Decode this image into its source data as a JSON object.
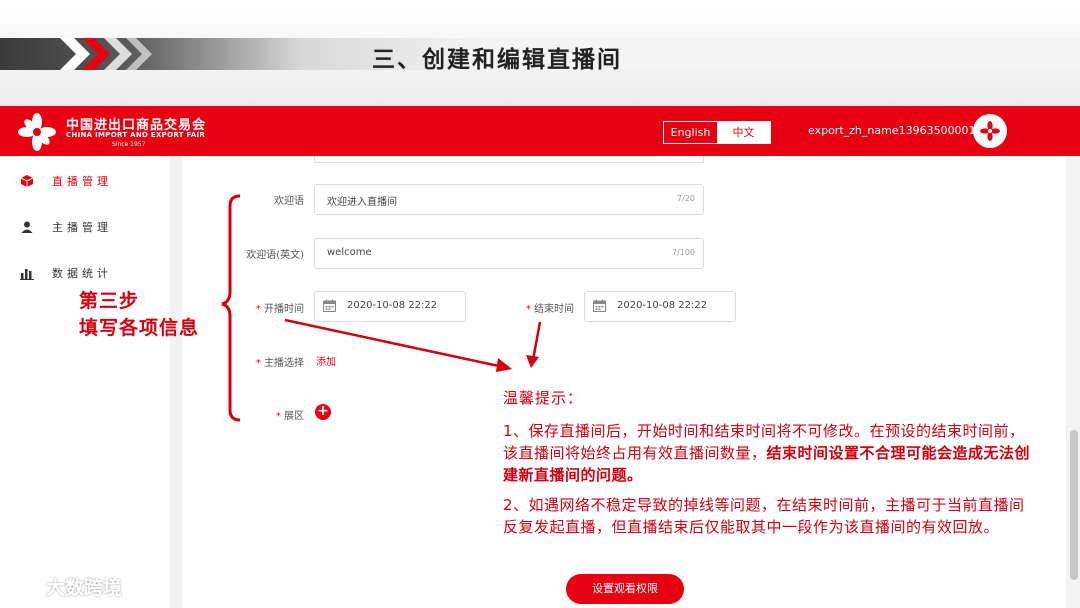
{
  "slide": {
    "title": "三、创建和编辑直播间"
  },
  "header": {
    "logo_cn": "中国进出口商品交易会",
    "logo_en": "CHINA IMPORT AND EXPORT FAIR",
    "logo_since": "Since 1957",
    "lang_en": "English",
    "lang_zh": "中文",
    "username": "export_zh_name13963500001"
  },
  "sidebar": {
    "items": [
      {
        "label": "直播管理",
        "icon": "cube-icon",
        "active": true
      },
      {
        "label": "主播管理",
        "icon": "user-icon",
        "active": false
      },
      {
        "label": "数据统计",
        "icon": "bar-chart-icon",
        "active": false
      }
    ]
  },
  "form": {
    "welcome": {
      "label": "欢迎语",
      "value": "欢迎进入直播间",
      "count": "7/20"
    },
    "welcome_en": {
      "label": "欢迎语(英文)",
      "value": "welcome",
      "count": "7/100"
    },
    "start_time": {
      "label": "开播时间",
      "value": "2020-10-08 22:22"
    },
    "end_time": {
      "label": "结束时间",
      "value": "2020-10-08 22:22"
    },
    "anchor": {
      "label": "主播选择",
      "link": "添加"
    },
    "booth": {
      "label": "展区",
      "button": "+"
    }
  },
  "annotation": {
    "step_line1": "第三步",
    "step_line2": "填写各项信息"
  },
  "tips": {
    "title": "温馨提示：",
    "p1_normal": "1、保存直播间后，开始时间和结束时间将不可修改。在预设的结束时间前，该直播间将始终占用有效直播间数量，",
    "p1_bold": "结束时间设置不合理可能会造成无法创建新直播间的问题。",
    "p2": "2、如遇网络不稳定导致的掉线等问题，在结束时间前，主播可于当前直播间反复发起直播，但直播结束后仅能取其中一段作为该直播间的有效回放。"
  },
  "buttons": {
    "view_permission": "设置观看权限"
  },
  "watermark": {
    "text": "大数跨境"
  },
  "colors": {
    "brand_red": "#e60012",
    "annotation_red": "#d40010"
  }
}
